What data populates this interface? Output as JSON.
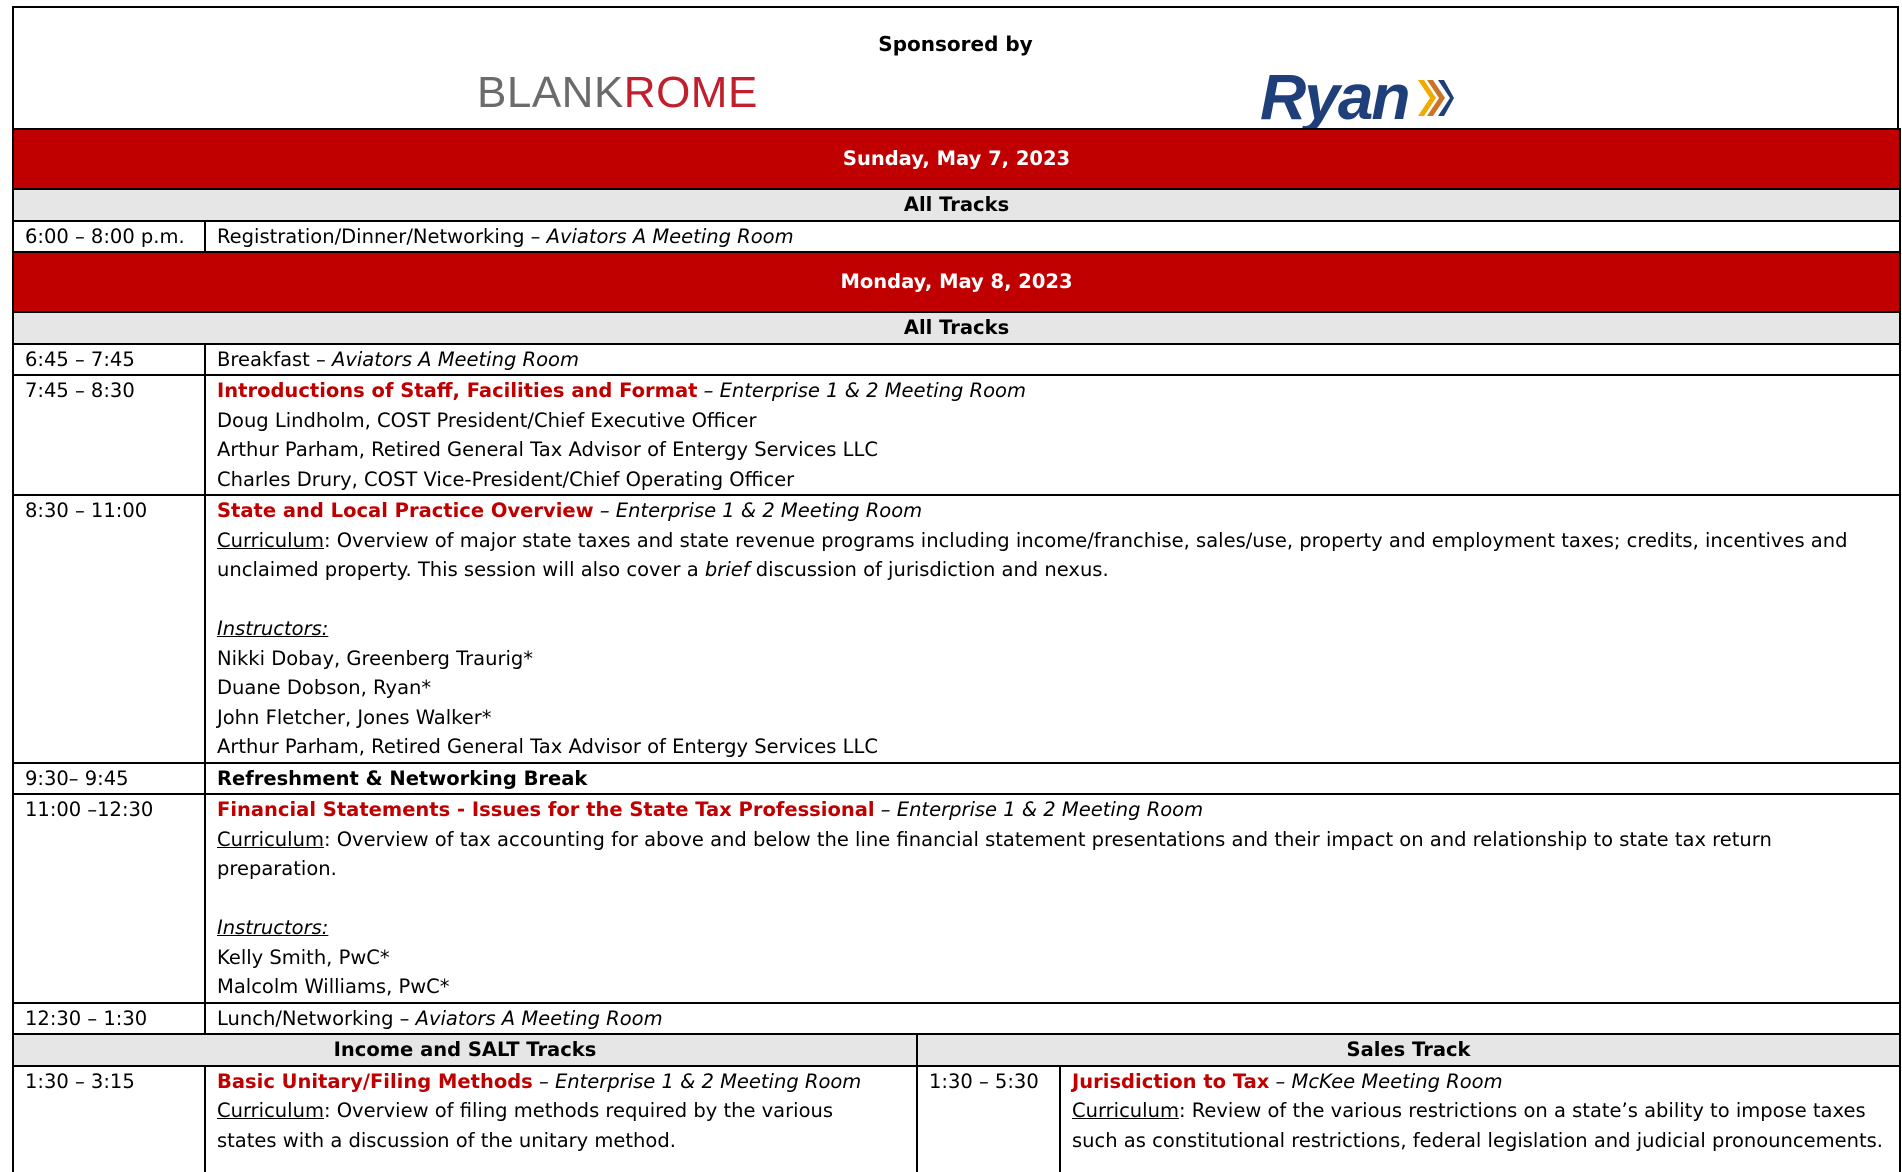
{
  "sponsor": {
    "label": "Sponsored by",
    "logos": [
      {
        "name": "BLANKROME",
        "part1": "BLANK",
        "part2": "ROME",
        "colors": {
          "blank": "#6b6b6b",
          "rome": "#c0202e"
        }
      },
      {
        "name": "Ryan",
        "color": "#1f3f7a",
        "mark_colors": [
          "#f2a900",
          "#c45a00",
          "#1f3f7a"
        ]
      }
    ]
  },
  "colors": {
    "day_header": "#c00000",
    "track_header": "#e6e6e6",
    "session_title": "#c00000"
  },
  "schedule": {
    "sunday": {
      "day": "Sunday, May 7, 2023",
      "track": "All Tracks",
      "rows": [
        {
          "time": "6:00 – 8:00 p.m.",
          "text": "Registration/Dinner/Networking – ",
          "room": "Aviators A Meeting Room"
        }
      ]
    },
    "monday": {
      "day": "Monday, May 8, 2023",
      "track": "All Tracks",
      "breakfast": {
        "time": "6:45 – 7:45",
        "text": "Breakfast – ",
        "room": "Aviators A Meeting Room"
      },
      "intro": {
        "time": "7:45 – 8:30",
        "title": "Introductions of Staff, Facilities and Format",
        "sep": " – ",
        "room": "Enterprise 1 & 2 Meeting Room",
        "people": [
          "Doug Lindholm, COST President/Chief Executive Officer",
          "Arthur Parham, Retired General Tax Advisor of Entergy Services LLC",
          "Charles Drury, COST Vice-President/Chief Operating Officer"
        ]
      },
      "overview": {
        "time": "8:30 – 11:00",
        "title": "State and Local Practice Overview",
        "sep": " – ",
        "room": "Enterprise 1 & 2 Meeting Room",
        "curriculum_label": "Curriculum",
        "curriculum_line1": ":  Overview of major state taxes and state revenue programs including income/franchise, sales/use, property and employment taxes; credits, incentives and",
        "curriculum_line2a": "unclaimed property. This session will also cover a ",
        "curriculum_emph": "brief",
        "curriculum_line2b": " discussion of jurisdiction and nexus.",
        "instructors_label": "Instructors:",
        "instructors": [
          "Nikki Dobay, Greenberg Traurig*",
          "Duane Dobson, Ryan*",
          "John Fletcher, Jones Walker*",
          "Arthur Parham, Retired General Tax Advisor of Entergy Services LLC"
        ]
      },
      "break": {
        "time": "9:30– 9:45",
        "text": "Refreshment & Networking Break"
      },
      "financial": {
        "time": "11:00 –12:30",
        "title": "Financial Statements - Issues for the State Tax Professional",
        "sep": " – ",
        "room": "Enterprise 1 & 2 Meeting Room",
        "curriculum_label": "Curriculum",
        "curriculum_line1": ":  Overview of tax accounting for above and below the line financial statement presentations and their impact on and relationship to state tax return",
        "curriculum_line2": "preparation.",
        "instructors_label": "Instructors:",
        "instructors": [
          "Kelly Smith, PwC*",
          "Malcolm Williams, PwC*"
        ]
      },
      "lunch": {
        "time": "12:30 – 1:30",
        "text": "Lunch/Networking – ",
        "room": "Aviators A Meeting Room"
      },
      "split_tracks": {
        "left": {
          "header": "Income and SALT Tracks",
          "time": "1:30 – 3:15",
          "title": "Basic Unitary/Filing Methods",
          "sep": " – ",
          "room": "Enterprise 1 & 2 Meeting Room",
          "curriculum_label": "Curriculum",
          "curriculum_line1": ":  Overview of filing methods required by the various",
          "curriculum_line2": "states with a discussion of the unitary method."
        },
        "right": {
          "header": "Sales Track",
          "time": "1:30 – 5:30",
          "title": "Jurisdiction to Tax",
          "sep": " – ",
          "room": "McKee Meeting Room",
          "curriculum_label": "Curriculum",
          "curriculum_line1": ": Review of the various restrictions on a state’s ability to impose taxes",
          "curriculum_line2": "such as constitutional restrictions, federal legislation and judicial pronouncements."
        }
      }
    }
  }
}
